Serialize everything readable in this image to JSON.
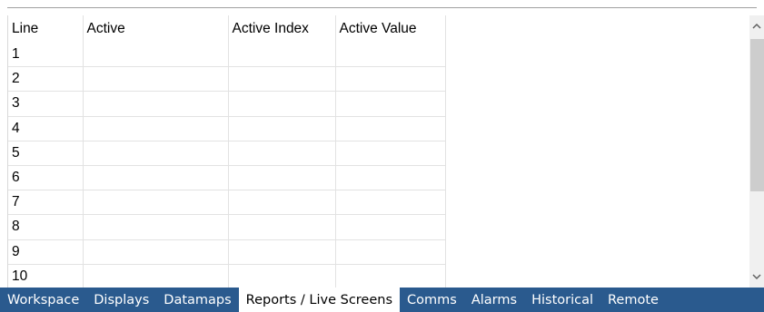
{
  "grid": {
    "columns": [
      "Line",
      "Active",
      "Active Index",
      "Active Value"
    ],
    "rows": [
      {
        "line": "1"
      },
      {
        "line": "2"
      },
      {
        "line": "3"
      },
      {
        "line": "4"
      },
      {
        "line": "5"
      },
      {
        "line": "6"
      },
      {
        "line": "7"
      },
      {
        "line": "8"
      },
      {
        "line": "9"
      },
      {
        "line": "10"
      }
    ]
  },
  "tabs": [
    "Workspace",
    "Displays",
    "Datamaps",
    "Reports / Live Screens",
    "Comms",
    "Alarms",
    "Historical",
    "Remote"
  ],
  "active_tab": "Reports / Live Screens",
  "icons": {
    "scroll_up": "chevron-up-icon",
    "scroll_down": "chevron-down-icon"
  },
  "colors": {
    "tab_bar": "#2a5a8e",
    "grid_line": "#e2e2e2"
  }
}
